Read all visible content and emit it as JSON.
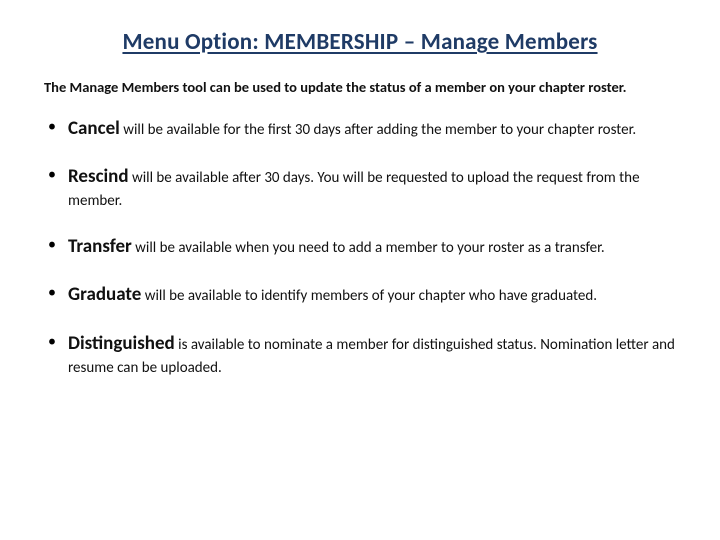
{
  "title": "Menu Option: MEMBERSHIP – Manage Members",
  "intro": "The Manage Members tool can be used to update the status of a member on your chapter roster.",
  "items": [
    {
      "term": "Cancel",
      "desc": " will be available for the first 30 days after adding the member to your chapter roster."
    },
    {
      "term": "Rescind",
      "desc": " will be available after 30 days. You will be requested to upload the request from the member."
    },
    {
      "term": "Transfer",
      "desc": " will be available when you need to add a member to your roster as a transfer."
    },
    {
      "term": "Graduate",
      "desc": " will be available to identify members of your chapter who have graduated."
    },
    {
      "term": "Distinguished",
      "desc": " is available to nominate a member for distinguished status. Nomination letter and resume can be uploaded."
    }
  ]
}
